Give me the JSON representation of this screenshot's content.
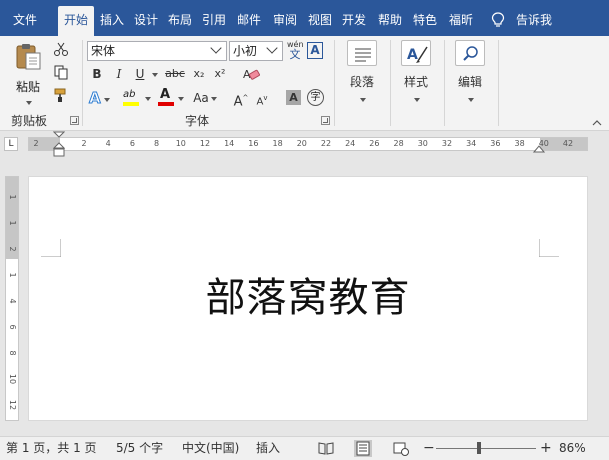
{
  "tabs": [
    {
      "label": "文件",
      "active": false
    },
    {
      "label": "开始",
      "active": true
    },
    {
      "label": "插入",
      "active": false
    },
    {
      "label": "设计",
      "active": false
    },
    {
      "label": "布局",
      "active": false
    },
    {
      "label": "引用",
      "active": false
    },
    {
      "label": "邮件",
      "active": false
    },
    {
      "label": "审阅",
      "active": false
    },
    {
      "label": "视图",
      "active": false
    },
    {
      "label": "开发",
      "active": false
    },
    {
      "label": "帮助",
      "active": false
    },
    {
      "label": "特色",
      "active": false
    },
    {
      "label": "福昕",
      "active": false
    }
  ],
  "tell_me": "告诉我",
  "clipboard": {
    "paste_label": "粘贴",
    "group_label": "剪贴板"
  },
  "font": {
    "name": "宋体",
    "size": "小初",
    "group_label": "字体",
    "wen_top": "wén",
    "wen_bottom": "文",
    "a_box": "A",
    "bold": "B",
    "italic": "I",
    "underline": "U",
    "strike": "abc",
    "subscript": "x₂",
    "superscript": "x²",
    "font_color_letter": "A",
    "highlight_letter": "ab",
    "case_label": "Aa",
    "grow": "A",
    "shrink": "A",
    "shade_letter": "A",
    "enclose_letter": "字"
  },
  "paragraph": {
    "label": "段落"
  },
  "styles": {
    "label": "样式"
  },
  "editing": {
    "label": "编辑"
  },
  "ruler": {
    "selector": "L",
    "marks": [
      "2",
      "2",
      "4",
      "6",
      "8",
      "10",
      "12",
      "14",
      "16",
      "18",
      "20",
      "22",
      "24",
      "26",
      "28",
      "30",
      "32",
      "34",
      "36",
      "38",
      "40",
      "42"
    ]
  },
  "vruler_marks": [
    "1",
    "1",
    "2",
    "1",
    "4",
    "6",
    "8",
    "10",
    "12"
  ],
  "document": {
    "text": "部落窝教育"
  },
  "status": {
    "page": "第 1 页，共 1 页",
    "words": "5/5 个字",
    "language": "中文(中国)",
    "mode": "插入",
    "zoom_minus": "−",
    "zoom_plus": "+",
    "zoom": "86%",
    "zoom_fraction": 0.86
  },
  "colors": {
    "ribbon_blue": "#2b579a",
    "highlight": "#ffff00",
    "font_color": "#e00000"
  }
}
